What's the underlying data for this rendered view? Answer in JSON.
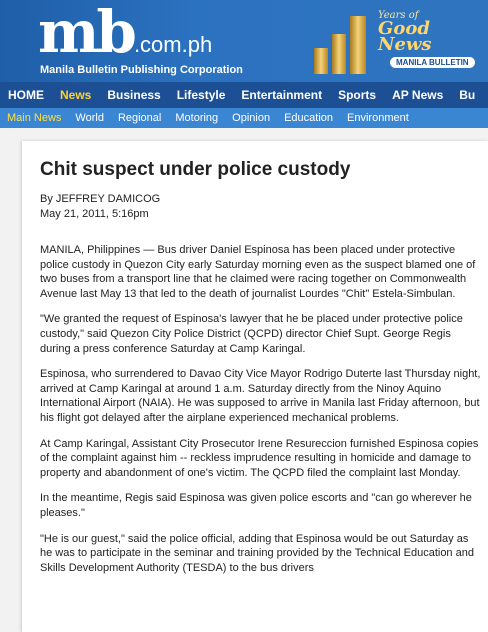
{
  "logo": {
    "mark": "mb",
    "domain": ".com.ph",
    "tagline": "Manila Bulletin Publishing Corporation"
  },
  "promo": {
    "small": "Years of",
    "big": "Good News",
    "badge": "MANILA BULLETIN"
  },
  "nav_primary": [
    "HOME",
    "News",
    "Business",
    "Lifestyle",
    "Entertainment",
    "Sports",
    "AP News",
    "Bu"
  ],
  "nav_primary_active": "News",
  "nav_secondary": [
    "Main News",
    "World",
    "Regional",
    "Motoring",
    "Opinion",
    "Education",
    "Environment"
  ],
  "nav_secondary_active": "Main News",
  "article": {
    "title": "Chit suspect under police custody",
    "byline": "By JEFFREY DAMICOG",
    "date": "May 21, 2011, 5:16pm",
    "paragraphs": [
      "MANILA, Philippines — Bus driver Daniel Espinosa has been placed under protective police custody in Quezon City early Saturday morning even as the suspect blamed one of two buses from a transport line that he claimed were racing together on Commonwealth Avenue last May 13 that led to the death of journalist Lourdes \"Chit\" Estela-Simbulan.",
      "\"We granted the request of Espinosa's lawyer that he be placed under protective police custody,\" said Quezon City Police District (QCPD) director Chief Supt. George Regis during a press conference Saturday at Camp Karingal.",
      "Espinosa, who surrendered to Davao City Vice Mayor Rodrigo Duterte last Thursday night, arrived at Camp Karingal at around 1 a.m. Saturday directly from the Ninoy Aquino International Airport (NAIA). He was supposed to arrive in Manila last Friday afternoon, but his flight got delayed after the airplane experienced mechanical problems.",
      "At Camp Karingal, Assistant City Prosecutor Irene Resureccion furnished Espinosa copies of the complaint against him -- reckless imprudence resulting in homicide and damage to property and abandonment of one's victim. The QCPD filed the complaint last Monday.",
      "In the meantime, Regis said Espinosa was given police escorts and \"can go wherever he pleases.\"",
      "\"He is our guest,\" said the police official, adding that Espinosa would be out Saturday as he was to participate in the seminar and training provided by the Technical Education and Skills Development Authority (TESDA) to the bus drivers"
    ]
  }
}
